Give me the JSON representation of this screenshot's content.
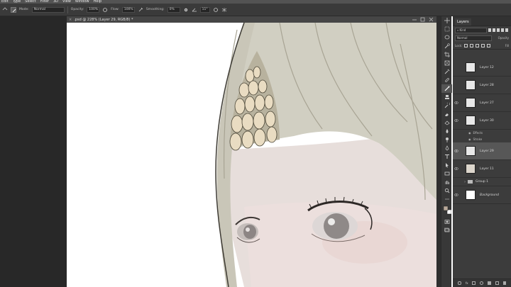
{
  "menu": [
    "Edit",
    "Type",
    "Select",
    "Filter",
    "3D",
    "View",
    "Window",
    "Help"
  ],
  "options": {
    "mode_label": "Mode:",
    "mode_value": "Normal",
    "opacity_label": "Opacity:",
    "opacity_value": "100%",
    "flow_label": "Flow:",
    "flow_value": "100%",
    "smoothing_label": "Smoothing:",
    "smoothing_value": "0%",
    "angle_value": "11°"
  },
  "document": {
    "tab_title": ".psd @ 228% (Layer 29, RGB/8) *"
  },
  "layers_panel": {
    "tab_label": "Layers",
    "kind_label": "Kind",
    "blend_mode": "Normal",
    "opacity_label": "Opacity",
    "lock_label": "Lock:",
    "fill_label": "Fill",
    "layers": [
      {
        "name": "Layer 12",
        "visible": false
      },
      {
        "name": "Layer 28",
        "visible": false
      },
      {
        "name": "Layer 27",
        "visible": true
      },
      {
        "name": "Layer 30",
        "visible": true
      },
      {
        "name": "Layer 29",
        "visible": true,
        "selected": true
      },
      {
        "name": "Layer 11",
        "visible": true
      },
      {
        "name": "Group 1",
        "visible": false,
        "group": true
      },
      {
        "name": "Background",
        "visible": true,
        "italic": true
      }
    ],
    "effects_label": "Effects",
    "stroke_label": "Stroke"
  }
}
